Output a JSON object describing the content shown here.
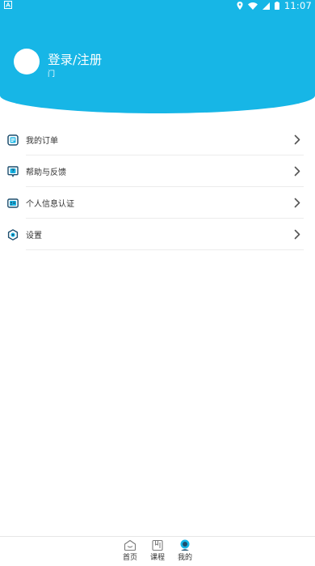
{
  "status_bar": {
    "time": "11:07",
    "icons": [
      "notification-icon",
      "location-icon",
      "wifi-icon",
      "signal-icon",
      "battery-icon"
    ]
  },
  "profile": {
    "title": "登录/注册",
    "subtitle": "门"
  },
  "menu": [
    {
      "label": "我的订单",
      "icon": "order-icon"
    },
    {
      "label": "帮助与反馈",
      "icon": "help-icon"
    },
    {
      "label": "个人信息认证",
      "icon": "id-card-icon"
    },
    {
      "label": "设置",
      "icon": "settings-icon"
    }
  ],
  "tabs": [
    {
      "label": "首页",
      "icon": "home-icon"
    },
    {
      "label": "课程",
      "icon": "course-icon"
    },
    {
      "label": "我的",
      "icon": "profile-icon",
      "active": true
    }
  ],
  "colors": {
    "brand": "#17b6e6",
    "icon_dark": "#1d4e6e",
    "chevron": "#555555"
  }
}
